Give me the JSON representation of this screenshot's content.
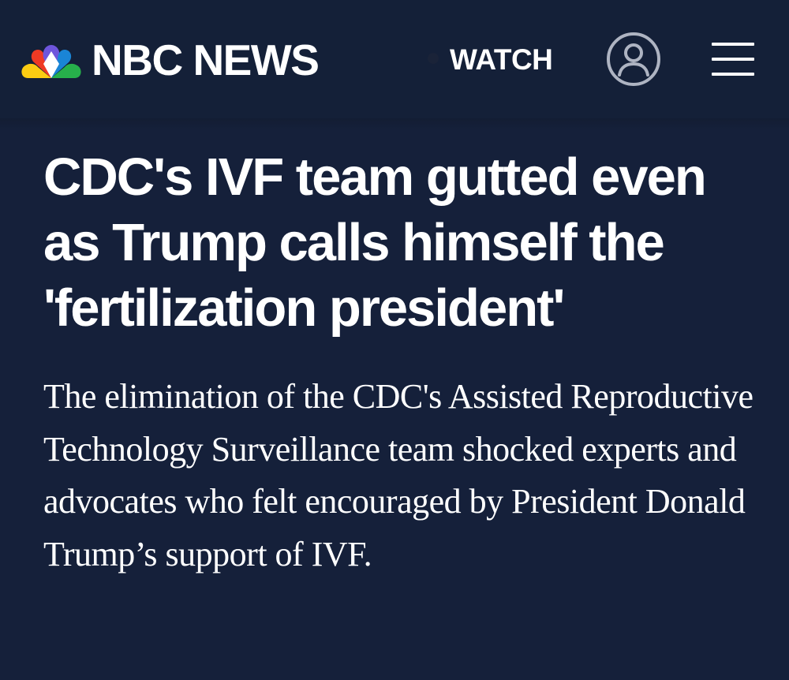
{
  "header": {
    "logo_text": "NBC NEWS",
    "logo_icon": "nbc-peacock-icon",
    "watch_label": "WATCH",
    "user_icon": "user-account-icon",
    "menu_icon": "hamburger-menu-icon",
    "colors": {
      "background": "#142038",
      "peacock": [
        "#fccc12",
        "#ef3a24",
        "#6e55dc",
        "#1a85d6",
        "#27b04b",
        "#f6a01a"
      ]
    }
  },
  "article": {
    "headline": "CDC's IVF team gutted even as Trump calls himself the 'fertilization president'",
    "dek": "The elimination of the CDC's Assisted Reproductive Technology Surveillance team shocked experts and advocates who felt encouraged by President Donald Trump’s support of IVF."
  },
  "colors": {
    "page_background": "#15203a",
    "text": "#ffffff"
  }
}
